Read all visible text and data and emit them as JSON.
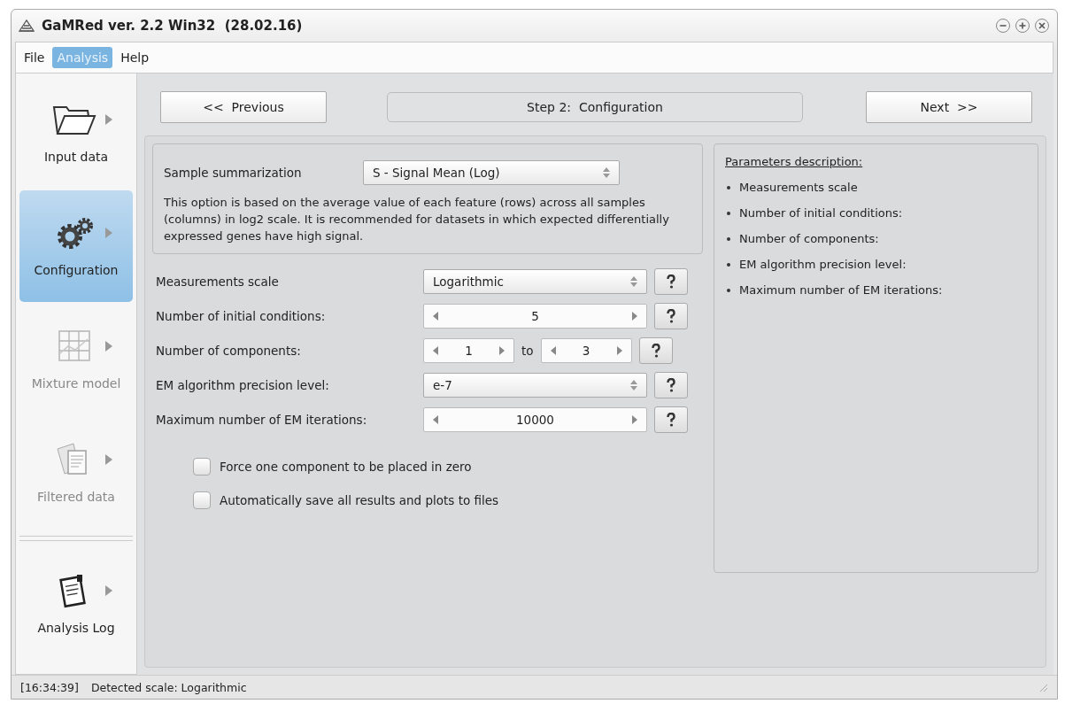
{
  "window": {
    "title": "GaMRed ver. 2.2 Win32  (28.02.16)"
  },
  "menu": [
    {
      "label": "File",
      "selected": false
    },
    {
      "label": "Analysis",
      "selected": true
    },
    {
      "label": "Help",
      "selected": false
    }
  ],
  "sidebar": {
    "items": [
      {
        "label": "Input data",
        "kind": "folder",
        "selected": false,
        "disabled": false
      },
      {
        "label": "Configuration",
        "kind": "gears",
        "selected": true,
        "disabled": false
      },
      {
        "label": "Mixture model",
        "kind": "chart",
        "selected": false,
        "disabled": true
      },
      {
        "label": "Filtered data",
        "kind": "documents",
        "selected": false,
        "disabled": true
      },
      {
        "label": "Analysis Log",
        "kind": "log",
        "selected": false,
        "disabled": false
      }
    ]
  },
  "navigation": {
    "previous": "<<  Previous",
    "step": "Step 2:  Configuration",
    "next": "Next  >>"
  },
  "summarization": {
    "label": "Sample summarization",
    "value": "S - Signal Mean (Log)",
    "description": "This option is based on the average value of each feature (rows) across all samples (columns) in log2 scale. It is recommended for datasets in which expected differentially expressed genes have high signal."
  },
  "parameters": [
    {
      "kind": "select",
      "label": "Measurements scale",
      "value": "Logarithmic"
    },
    {
      "kind": "spinner",
      "label": "Number of initial conditions:",
      "value": "5"
    },
    {
      "kind": "range",
      "label": "Number of components:",
      "from": "1",
      "joiner": "to",
      "to": "3"
    },
    {
      "kind": "select",
      "label": "EM algorithm precision level:",
      "value": "e-7"
    },
    {
      "kind": "spinner",
      "label": "Maximum number of EM iterations:",
      "value": "10000"
    }
  ],
  "options": [
    {
      "label": "Force one component to be placed in zero",
      "checked": false
    },
    {
      "label": "Automatically save all results and plots to files",
      "checked": false
    }
  ],
  "description_panel": {
    "title": "Parameters description:",
    "items": [
      "Measurements scale",
      "Number of initial conditions:",
      "Number of components:",
      "EM algorithm precision level:",
      "Maximum number of EM iterations:"
    ]
  },
  "status_bar": {
    "time": "[16:34:39]",
    "message": "Detected scale: Logarithmic"
  }
}
